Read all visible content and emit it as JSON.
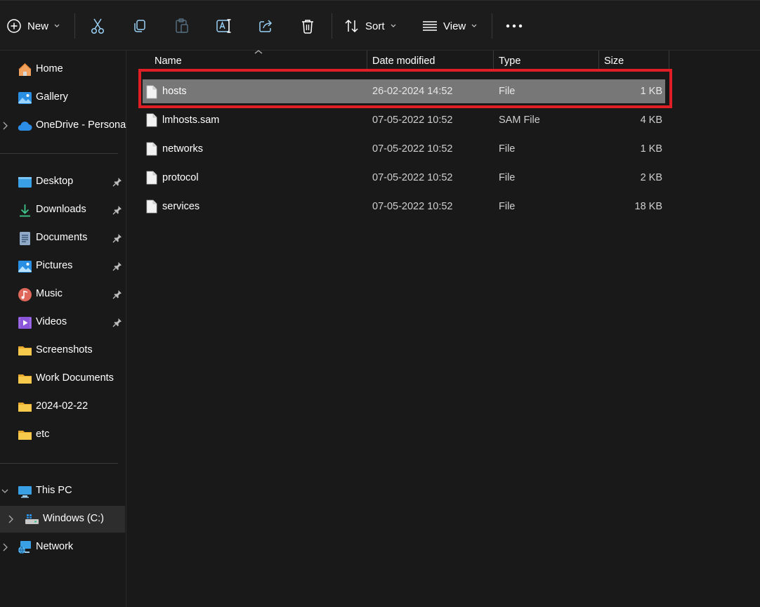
{
  "toolbar": {
    "new_label": "New",
    "sort_label": "Sort",
    "view_label": "View",
    "icons": [
      "add-circle-icon",
      "cut-icon",
      "copy-icon",
      "paste-icon",
      "rename-icon",
      "share-icon",
      "delete-icon",
      "sort-icon",
      "view-icon",
      "more-icon"
    ]
  },
  "sidebar": {
    "home": "Home",
    "gallery": "Gallery",
    "onedrive": "OneDrive - Persona",
    "desktop": "Desktop",
    "downloads": "Downloads",
    "documents": "Documents",
    "pictures": "Pictures",
    "music": "Music",
    "videos": "Videos",
    "screenshots": "Screenshots",
    "work_documents": "Work Documents",
    "folder_date": "2024-02-22",
    "etc": "etc",
    "this_pc": "This PC",
    "windows_c": "Windows (C:)",
    "network": "Network"
  },
  "columns": {
    "name": "Name",
    "date": "Date modified",
    "type": "Type",
    "size": "Size"
  },
  "files": [
    {
      "name": "hosts",
      "date": "26-02-2024 14:52",
      "type": "File",
      "size": "1 KB"
    },
    {
      "name": "lmhosts.sam",
      "date": "07-05-2022 10:52",
      "type": "SAM File",
      "size": "4 KB"
    },
    {
      "name": "networks",
      "date": "07-05-2022 10:52",
      "type": "File",
      "size": "1 KB"
    },
    {
      "name": "protocol",
      "date": "07-05-2022 10:52",
      "type": "File",
      "size": "2 KB"
    },
    {
      "name": "services",
      "date": "07-05-2022 10:52",
      "type": "File",
      "size": "18 KB"
    }
  ],
  "colors": {
    "background": "#191919",
    "selected_row": "#777777",
    "highlight_box": "#e01e26",
    "folder": "#f3c336",
    "accent": "#4cc2ff"
  }
}
